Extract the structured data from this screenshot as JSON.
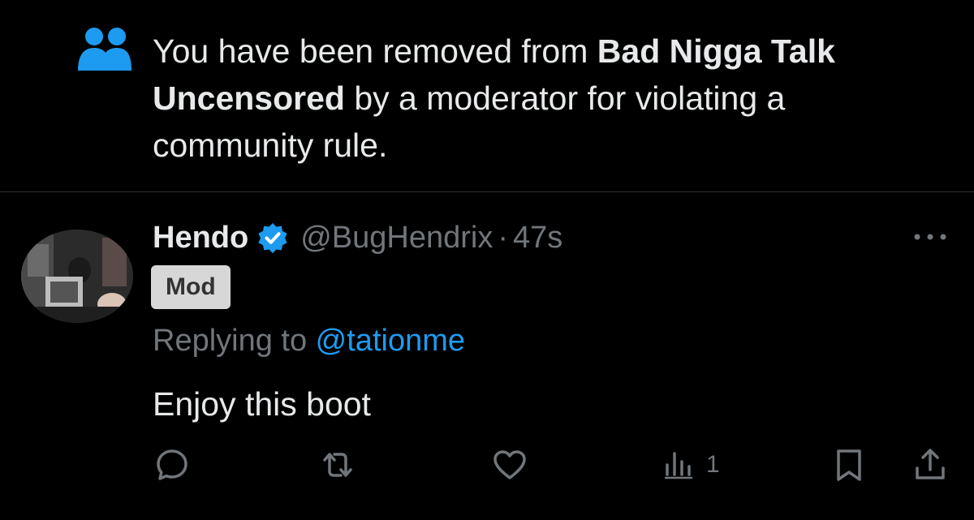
{
  "notice": {
    "prefix": "You have been removed from ",
    "community_name": "Bad Nigga Talk Uncensored",
    "suffix": " by a moderator for violating a community rule."
  },
  "tweet": {
    "display_name": "Hendo",
    "handle": "@BugHendrix",
    "separator": "·",
    "time": "47s",
    "badge": "Mod",
    "replying_prefix": "Replying to ",
    "replying_handle": "@tationme",
    "text": "Enjoy this boot",
    "views": "1"
  },
  "colors": {
    "background": "#000000",
    "text": "#e7e9ea",
    "secondary": "#71767b",
    "accent": "#1d9bf0",
    "badge_bg": "#d7d7d7"
  },
  "icons": {
    "notice": "people-icon",
    "verified": "verified-badge-icon",
    "more": "more-dots-icon",
    "reply": "reply-icon",
    "retweet": "retweet-icon",
    "like": "heart-icon",
    "views": "views-icon",
    "bookmark": "bookmark-icon",
    "share": "share-icon"
  }
}
